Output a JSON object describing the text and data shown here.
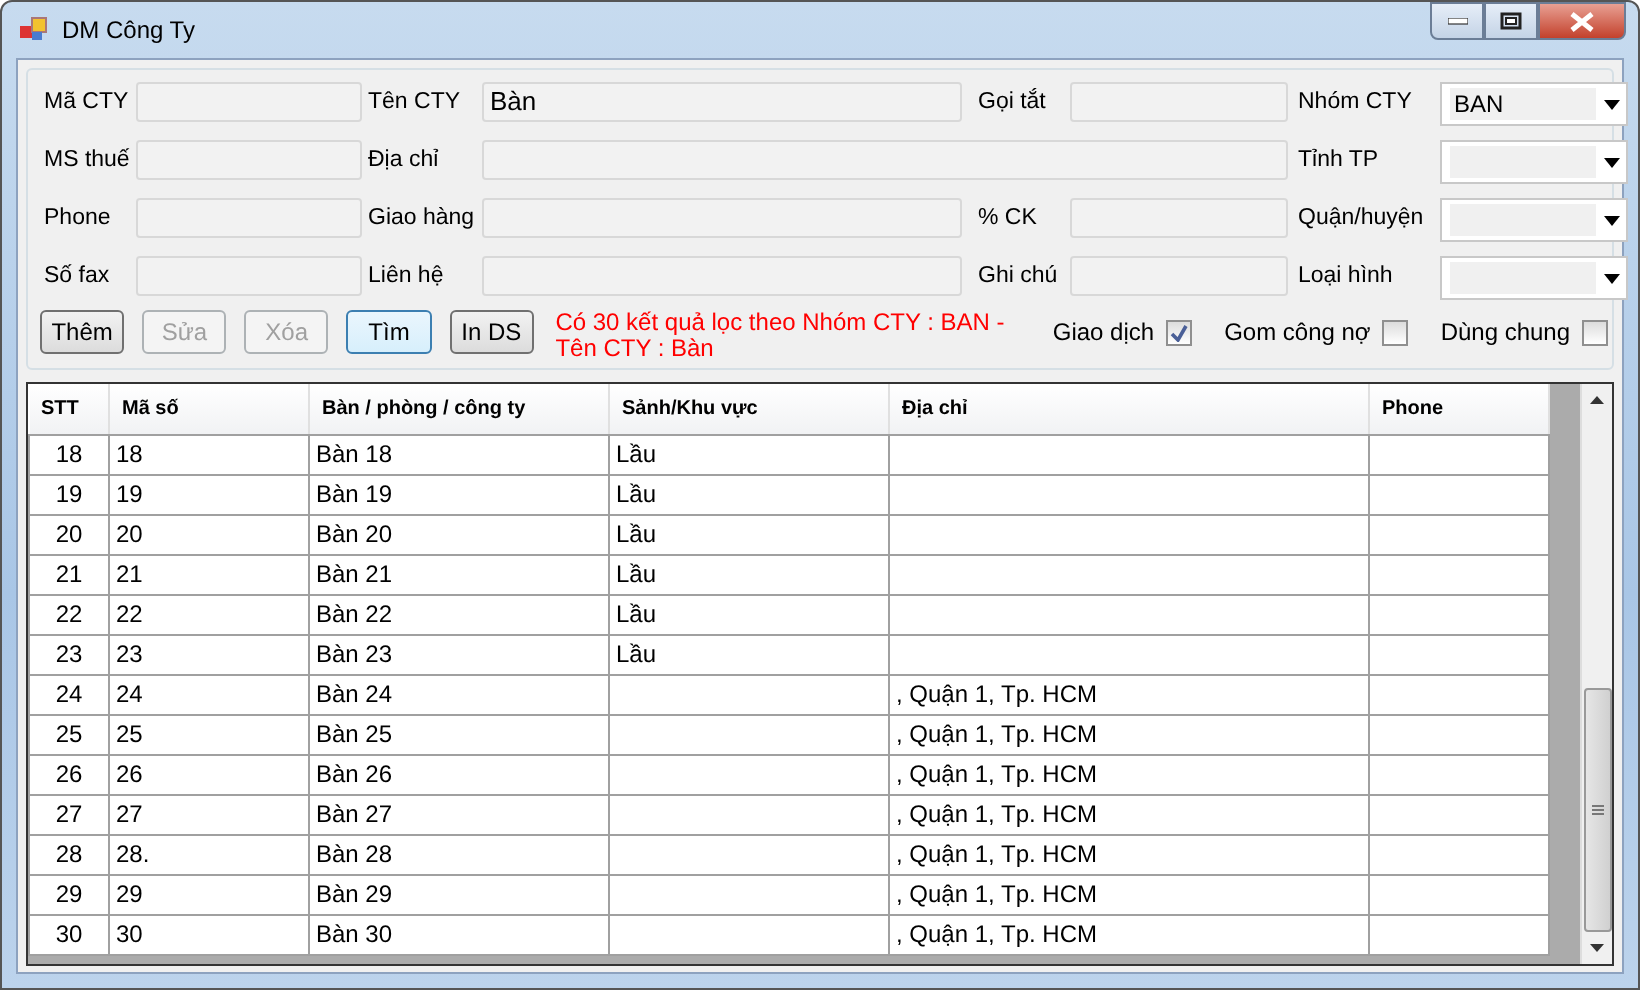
{
  "window": {
    "title": "DM Công Ty"
  },
  "form_rows": [
    [
      {
        "label": "Mã CTY",
        "kind": "text"
      },
      {
        "label": "Tên CTY",
        "value": "Bàn",
        "kind": "text"
      },
      {
        "label": "Gọi tắt",
        "kind": "text"
      },
      {
        "label": "Nhóm CTY",
        "value": "BAN",
        "kind": "combo"
      }
    ],
    [
      {
        "label": "MS thuế",
        "kind": "text"
      },
      {
        "label": "Địa chỉ",
        "kind": "text"
      },
      {
        "label": "Tỉnh TP",
        "kind": "combo"
      }
    ],
    [
      {
        "label": "Phone",
        "kind": "text"
      },
      {
        "label": "Giao hàng",
        "kind": "text"
      },
      {
        "label": "% CK",
        "kind": "text"
      },
      {
        "label": "Quận/huyện",
        "kind": "combo"
      }
    ],
    [
      {
        "label": "Số fax",
        "kind": "text"
      },
      {
        "label": "Liên hệ",
        "kind": "text"
      },
      {
        "label": "Ghi chú",
        "kind": "text"
      },
      {
        "label": "Loại hình",
        "kind": "combo"
      }
    ]
  ],
  "buttons": [
    {
      "label": "Thêm",
      "disabled": false,
      "focused": false
    },
    {
      "label": "Sửa",
      "disabled": true,
      "focused": false
    },
    {
      "label": "Xóa",
      "disabled": true,
      "focused": false
    },
    {
      "label": "Tìm",
      "disabled": false,
      "focused": true
    },
    {
      "label": "In DS",
      "disabled": false,
      "focused": false
    }
  ],
  "message": "Có 30 kết quả lọc theo Nhóm CTY : BAN - Tên CTY : Bàn",
  "checkboxes": [
    {
      "label": "Giao dịch",
      "checked": true
    },
    {
      "label": "Gom công nợ",
      "checked": false
    },
    {
      "label": "Dùng chung",
      "checked": false
    }
  ],
  "table": {
    "columns": [
      "STT",
      "Mã số",
      "Bàn / phòng / công ty",
      "Sảnh/Khu vực",
      "Địa chỉ",
      "Phone"
    ],
    "rows": [
      [
        "18",
        "18",
        "Bàn 18",
        "Lầu",
        "",
        ""
      ],
      [
        "19",
        "19",
        "Bàn 19",
        "Lầu",
        "",
        ""
      ],
      [
        "20",
        "20",
        "Bàn 20",
        "Lầu",
        "",
        ""
      ],
      [
        "21",
        "21",
        "Bàn 21",
        "Lầu",
        "",
        ""
      ],
      [
        "22",
        "22",
        "Bàn 22",
        "Lầu",
        "",
        ""
      ],
      [
        "23",
        "23",
        "Bàn 23",
        "Lầu",
        "",
        ""
      ],
      [
        "24",
        "24",
        "Bàn 24",
        "",
        ", Quận 1, Tp. HCM",
        ""
      ],
      [
        "25",
        "25",
        "Bàn 25",
        "",
        ", Quận 1, Tp. HCM",
        ""
      ],
      [
        "26",
        "26",
        "Bàn 26",
        "",
        ", Quận 1, Tp. HCM",
        ""
      ],
      [
        "27",
        "27",
        "Bàn 27",
        "",
        ", Quận 1, Tp. HCM",
        ""
      ],
      [
        "28",
        "28.",
        "Bàn 28",
        "",
        ", Quận 1, Tp. HCM",
        ""
      ],
      [
        "29",
        "29",
        "Bàn 29",
        "",
        ", Quận 1, Tp. HCM",
        ""
      ],
      [
        "30",
        "30",
        "Bàn 30",
        "",
        ", Quận 1, Tp. HCM",
        ""
      ]
    ]
  }
}
